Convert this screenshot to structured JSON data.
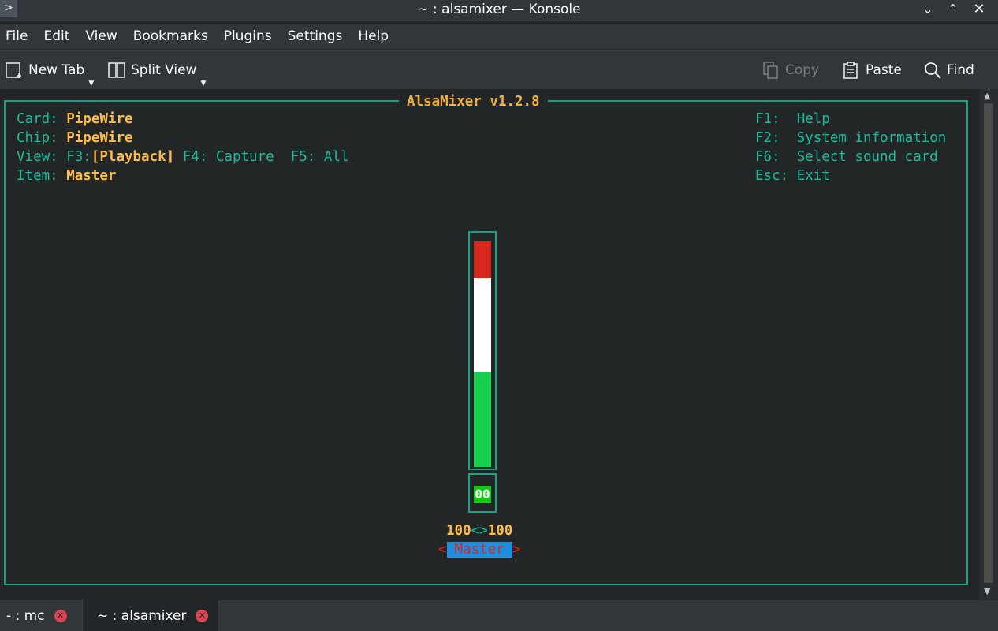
{
  "window": {
    "title": "~ : alsamixer — Konsole",
    "app_icon": "terminal-icon",
    "controls": [
      "minimize-icon",
      "maximize-icon",
      "close-icon"
    ]
  },
  "menubar": {
    "items": [
      "File",
      "Edit",
      "View",
      "Bookmarks",
      "Plugins",
      "Settings",
      "Help"
    ]
  },
  "toolbar": {
    "new_tab": "New Tab",
    "split_view": "Split View",
    "copy": "Copy",
    "paste": "Paste",
    "find": "Find"
  },
  "alsamixer": {
    "title": "AlsaMixer v1.2.8",
    "card_label": "Card:",
    "card": "PipeWire",
    "chip_label": "Chip:",
    "chip": "PipeWire",
    "view_label": "View:",
    "view_f3_key": "F3:",
    "view_f3": "[Playback]",
    "view_f4": "F4: Capture",
    "view_f5": "F5: All",
    "item_label": "Item:",
    "item": "Master",
    "help": [
      {
        "key": "F1:",
        "action": "Help"
      },
      {
        "key": "F2:",
        "action": "System information"
      },
      {
        "key": "F6:",
        "action": "Select sound card"
      },
      {
        "key": "Esc:",
        "action": "Exit"
      }
    ],
    "control": {
      "name": "Master",
      "level_percent": 100,
      "mute_value": "00",
      "left": "100",
      "separator": "<>",
      "right": "100",
      "left_bracket": "<",
      "right_bracket": ">"
    },
    "colors": {
      "border": "#1aa286",
      "value": "#fdbc4b",
      "red": "#d8281e",
      "green": "#17cf4e"
    }
  },
  "tabs": [
    {
      "label": "- : mc"
    },
    {
      "label": "~ : alsamixer",
      "active": true
    }
  ]
}
